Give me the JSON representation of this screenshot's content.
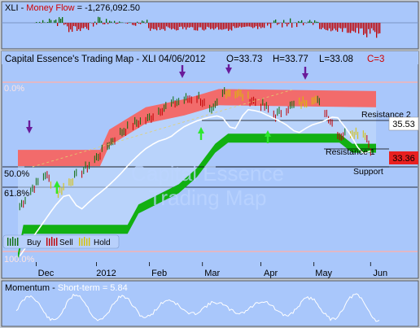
{
  "colors": {
    "background_outer": "#c8cfd8",
    "panel_bg": "#a9c7fb",
    "money_flow_bg": "#a9c7fb",
    "sell_zone": "#f26b6b",
    "buy_zone": "#12b012",
    "price_up": "#0b6b0b",
    "price_down": "#c00000",
    "price_hold": "#d8c000",
    "trend_line": "#ffffff",
    "momentum_line": "#ffffff",
    "arrow_sell": "#6a1b9a",
    "arrow_buy": "#2ee82e",
    "current_price_bg": "#e82020",
    "title_red": "#d00000"
  },
  "money_flow": {
    "symbol": "XLI",
    "label": "Money Flow",
    "value": "-1,276,092.50"
  },
  "trading_map": {
    "title": "Capital Essence's Trading Map - XLI 04/06/2012",
    "open_label": "O=33.73",
    "high_label": "H=33.77",
    "low_label": "L=33.08",
    "cycle_label": "C=3",
    "watermark_line1": "Capital Essence",
    "watermark_line2": "Trading Map",
    "resistance2_label": "Resistance 2",
    "resistance2_value": "35.53",
    "resistance1_label": "Resistance 1",
    "support_label": "Support",
    "current_price": "33.36",
    "fib_levels": [
      "0.0%",
      "50.0%",
      "61.8%",
      "100.0%"
    ],
    "legend": [
      {
        "name": "Buy",
        "icon": "buy-bars-icon"
      },
      {
        "name": "Sell",
        "icon": "sell-bars-icon"
      },
      {
        "name": "Hold",
        "icon": "hold-bars-icon"
      }
    ],
    "x_ticks": [
      "Dec",
      "2012",
      "Feb",
      "Mar",
      "Apr",
      "May",
      "Jun"
    ]
  },
  "momentum": {
    "label": "Momentum",
    "short_term_label": "Short-term = 5.84"
  },
  "chart_data": {
    "type": "line",
    "title": "Capital Essence's Trading Map - XLI 04/06/2012",
    "x_range": [
      "2011-11-21",
      "2012-06-04"
    ],
    "y_range_price": [
      28.0,
      37.0
    ],
    "resistance2": 35.53,
    "current_price": 33.36,
    "ohlc_last": {
      "open": 33.73,
      "high": 33.77,
      "low": 33.08
    },
    "price_series": [
      [
        "2011-11-22",
        30.5
      ],
      [
        "2011-11-29",
        31.4
      ],
      [
        "2011-12-06",
        32.1
      ],
      [
        "2011-12-13",
        31.2
      ],
      [
        "2011-12-20",
        31.8
      ],
      [
        "2011-12-27",
        32.3
      ],
      [
        "2012-01-03",
        32.9
      ],
      [
        "2012-01-10",
        33.6
      ],
      [
        "2012-01-17",
        34.2
      ],
      [
        "2012-01-24",
        34.6
      ],
      [
        "2012-01-31",
        34.8
      ],
      [
        "2012-02-07",
        35.3
      ],
      [
        "2012-02-14",
        35.6
      ],
      [
        "2012-02-21",
        35.8
      ],
      [
        "2012-02-28",
        35.9
      ],
      [
        "2012-03-06",
        35.1
      ],
      [
        "2012-03-13",
        36.2
      ],
      [
        "2012-03-20",
        36.1
      ],
      [
        "2012-03-27",
        35.8
      ],
      [
        "2012-04-03",
        35.5
      ],
      [
        "2012-04-10",
        35.0
      ],
      [
        "2012-04-17",
        35.4
      ],
      [
        "2012-04-24",
        35.6
      ],
      [
        "2012-05-01",
        35.9
      ],
      [
        "2012-05-08",
        35.1
      ],
      [
        "2012-05-15",
        34.0
      ],
      [
        "2012-05-22",
        34.2
      ],
      [
        "2012-05-29",
        34.1
      ],
      [
        "2012-06-01",
        33.36
      ]
    ],
    "resistance_band": [
      [
        "2011-11-21",
        33.3
      ],
      [
        "2012-01-05",
        33.3
      ],
      [
        "2012-01-10",
        34.3
      ],
      [
        "2012-01-30",
        35.4
      ],
      [
        "2012-02-20",
        35.8
      ],
      [
        "2012-03-10",
        36.3
      ],
      [
        "2012-06-04",
        36.2
      ]
    ],
    "support_band": [
      [
        "2011-11-21",
        28.2
      ],
      [
        "2011-11-24",
        29.6
      ],
      [
        "2012-01-20",
        29.6
      ],
      [
        "2012-01-26",
        30.6
      ],
      [
        "2012-02-17",
        31.6
      ],
      [
        "2012-02-27",
        32.4
      ],
      [
        "2012-03-08",
        33.6
      ],
      [
        "2012-03-15",
        34.1
      ],
      [
        "2012-05-15",
        34.1
      ],
      [
        "2012-05-22",
        33.6
      ],
      [
        "2012-06-04",
        33.6
      ]
    ]
  }
}
